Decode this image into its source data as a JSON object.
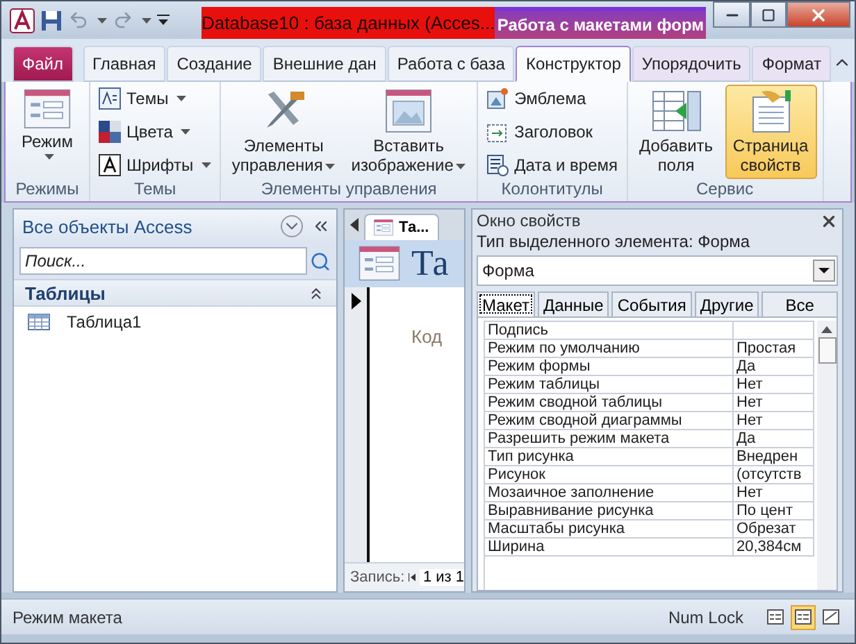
{
  "window": {
    "title": "Database10 : база данных (Acces...",
    "context_title": "Работа с макетами форм"
  },
  "ribbon_tabs": [
    {
      "label": "Файл",
      "kind": "file",
      "selected": false
    },
    {
      "label": "Главная",
      "kind": "tab",
      "selected": false
    },
    {
      "label": "Создание",
      "kind": "tab",
      "selected": false
    },
    {
      "label": "Внешние дан",
      "kind": "tab",
      "selected": false
    },
    {
      "label": "Работа с база",
      "kind": "tab",
      "selected": false
    },
    {
      "label": "Конструктор",
      "kind": "context",
      "selected": true
    },
    {
      "label": "Упорядочить",
      "kind": "context",
      "selected": false
    },
    {
      "label": "Формат",
      "kind": "context",
      "selected": false
    }
  ],
  "ribbon_groups": [
    {
      "label": "Режимы",
      "items": [
        {
          "label": "Режим",
          "kind": "large",
          "dropdown": true,
          "selected": false
        }
      ]
    },
    {
      "label": "Темы",
      "items": [
        {
          "label": "Темы",
          "kind": "small",
          "dropdown": true,
          "selected": false
        },
        {
          "label": "Цвета",
          "kind": "small",
          "dropdown": true,
          "selected": false
        },
        {
          "label": "Шрифты",
          "kind": "small",
          "dropdown": true,
          "selected": false
        }
      ]
    },
    {
      "label": "Элементы управления",
      "items": [
        {
          "label": "Элементы управления",
          "kind": "large",
          "dropdown": true,
          "selected": false
        },
        {
          "label": "Вставить изображение",
          "kind": "large",
          "dropdown": true,
          "selected": false
        }
      ]
    },
    {
      "label": "Колонтитулы",
      "items": [
        {
          "label": "Эмблема",
          "kind": "small",
          "dropdown": false,
          "selected": false
        },
        {
          "label": "Заголовок",
          "kind": "small",
          "dropdown": false,
          "selected": false
        },
        {
          "label": "Дата и время",
          "kind": "small",
          "dropdown": false,
          "selected": false
        }
      ]
    },
    {
      "label": "Сервис",
      "items": [
        {
          "label": "Добавить поля",
          "kind": "large",
          "dropdown": false,
          "selected": false
        },
        {
          "label": "Страница свойств",
          "kind": "large",
          "dropdown": false,
          "selected": true
        }
      ]
    }
  ],
  "nav_pane": {
    "title": "Все объекты Access",
    "search": {
      "placeholder": "Поиск..."
    },
    "groups": [
      {
        "label": "Таблицы",
        "expanded": true,
        "items": [
          {
            "label": "Таблица1"
          }
        ]
      }
    ]
  },
  "document": {
    "tab": {
      "label": "Та..."
    },
    "header_title": "Та",
    "field_label": "Код",
    "record_nav": {
      "label": "Запись:",
      "position": "1 из 1"
    }
  },
  "property_sheet": {
    "title": "Окно свойств",
    "selection_type_label": "Тип выделенного элемента:",
    "selection_type": "Форма",
    "selector_value": "Форма",
    "tabs": [
      {
        "label": "Макет",
        "selected": true
      },
      {
        "label": "Данные",
        "selected": false
      },
      {
        "label": "События",
        "selected": false
      },
      {
        "label": "Другие",
        "selected": false
      },
      {
        "label": "Все",
        "selected": false
      }
    ],
    "rows": [
      {
        "name": "Подпись",
        "value": ""
      },
      {
        "name": "Режим по умолчанию",
        "value": "Простая"
      },
      {
        "name": "Режим формы",
        "value": "Да"
      },
      {
        "name": "Режим таблицы",
        "value": "Нет"
      },
      {
        "name": "Режим сводной таблицы",
        "value": "Нет"
      },
      {
        "name": "Режим сводной диаграммы",
        "value": "Нет"
      },
      {
        "name": "Разрешить режим макета",
        "value": "Да"
      },
      {
        "name": "Тип рисунка",
        "value": "Внедрен"
      },
      {
        "name": "Рисунок",
        "value": "(отсутств"
      },
      {
        "name": "Мозаичное заполнение",
        "value": "Нет"
      },
      {
        "name": "Выравнивание рисунка",
        "value": "По цент"
      },
      {
        "name": "Масштабы рисунка",
        "value": "Обрезат"
      },
      {
        "name": "Ширина",
        "value": "20,384см"
      }
    ]
  },
  "status_bar": {
    "text": "Режим макета",
    "indicators": [
      "Num Lock"
    ],
    "views": [
      {
        "selected": false
      },
      {
        "selected": true
      },
      {
        "selected": false
      }
    ]
  }
}
